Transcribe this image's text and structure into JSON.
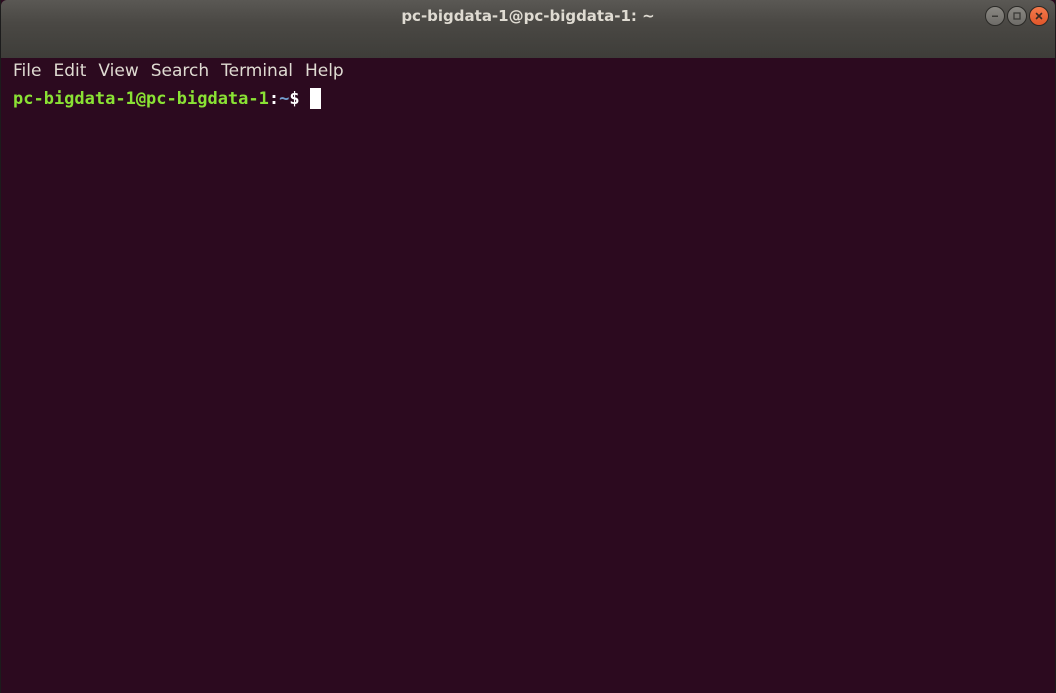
{
  "window": {
    "title": "pc-bigdata-1@pc-bigdata-1: ~"
  },
  "controls": {
    "minimize_icon": "minimize-icon",
    "maximize_icon": "maximize-icon",
    "close_icon": "close-icon"
  },
  "menubar": {
    "items": [
      {
        "label": "File"
      },
      {
        "label": "Edit"
      },
      {
        "label": "View"
      },
      {
        "label": "Search"
      },
      {
        "label": "Terminal"
      },
      {
        "label": "Help"
      }
    ]
  },
  "terminal": {
    "prompt_userhost": "pc-bigdata-1@pc-bigdata-1",
    "prompt_colon": ":",
    "prompt_path": "~",
    "prompt_symbol": "$",
    "input": ""
  },
  "colors": {
    "background": "#2c0a1f",
    "userhost": "#8ae234",
    "path": "#729fcf",
    "close_button": "#e95420"
  }
}
